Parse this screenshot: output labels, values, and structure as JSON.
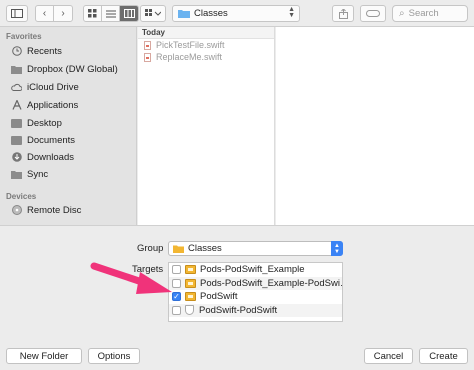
{
  "toolbar": {
    "back_glyph": "‹",
    "forward_glyph": "›",
    "path_folder": "Classes",
    "search_placeholder": "Search"
  },
  "sidebar": {
    "favorites_title": "Favorites",
    "favorites": [
      {
        "label": "Recents",
        "icon": "clock-icon"
      },
      {
        "label": "Dropbox (DW Global)",
        "icon": "folder-icon"
      },
      {
        "label": "iCloud Drive",
        "icon": "cloud-icon"
      },
      {
        "label": "Applications",
        "icon": "applications-icon"
      },
      {
        "label": "Desktop",
        "icon": "desktop-icon"
      },
      {
        "label": "Documents",
        "icon": "documents-icon"
      },
      {
        "label": "Downloads",
        "icon": "downloads-icon"
      },
      {
        "label": "Sync",
        "icon": "folder-icon"
      }
    ],
    "devices_title": "Devices",
    "devices": [
      {
        "label": "Remote Disc",
        "icon": "disc-icon"
      }
    ]
  },
  "browser": {
    "column_header": "Today",
    "files": [
      "PickTestFile.swift",
      "ReplaceMe.swift"
    ]
  },
  "options": {
    "group_label": "Group",
    "group_value": "Classes",
    "targets_label": "Targets",
    "targets": [
      {
        "label": "Pods-PodSwift_Example",
        "checked": false
      },
      {
        "label": "Pods-PodSwift_Example-PodSwi…",
        "checked": false
      },
      {
        "label": "PodSwift",
        "checked": true
      },
      {
        "label": "PodSwift-PodSwift",
        "checked": false
      }
    ]
  },
  "footer": {
    "new_folder": "New Folder",
    "options": "Options",
    "cancel": "Cancel",
    "create": "Create"
  },
  "colors": {
    "accent": "#3a83f5",
    "annotation_arrow": "#f0337a"
  }
}
